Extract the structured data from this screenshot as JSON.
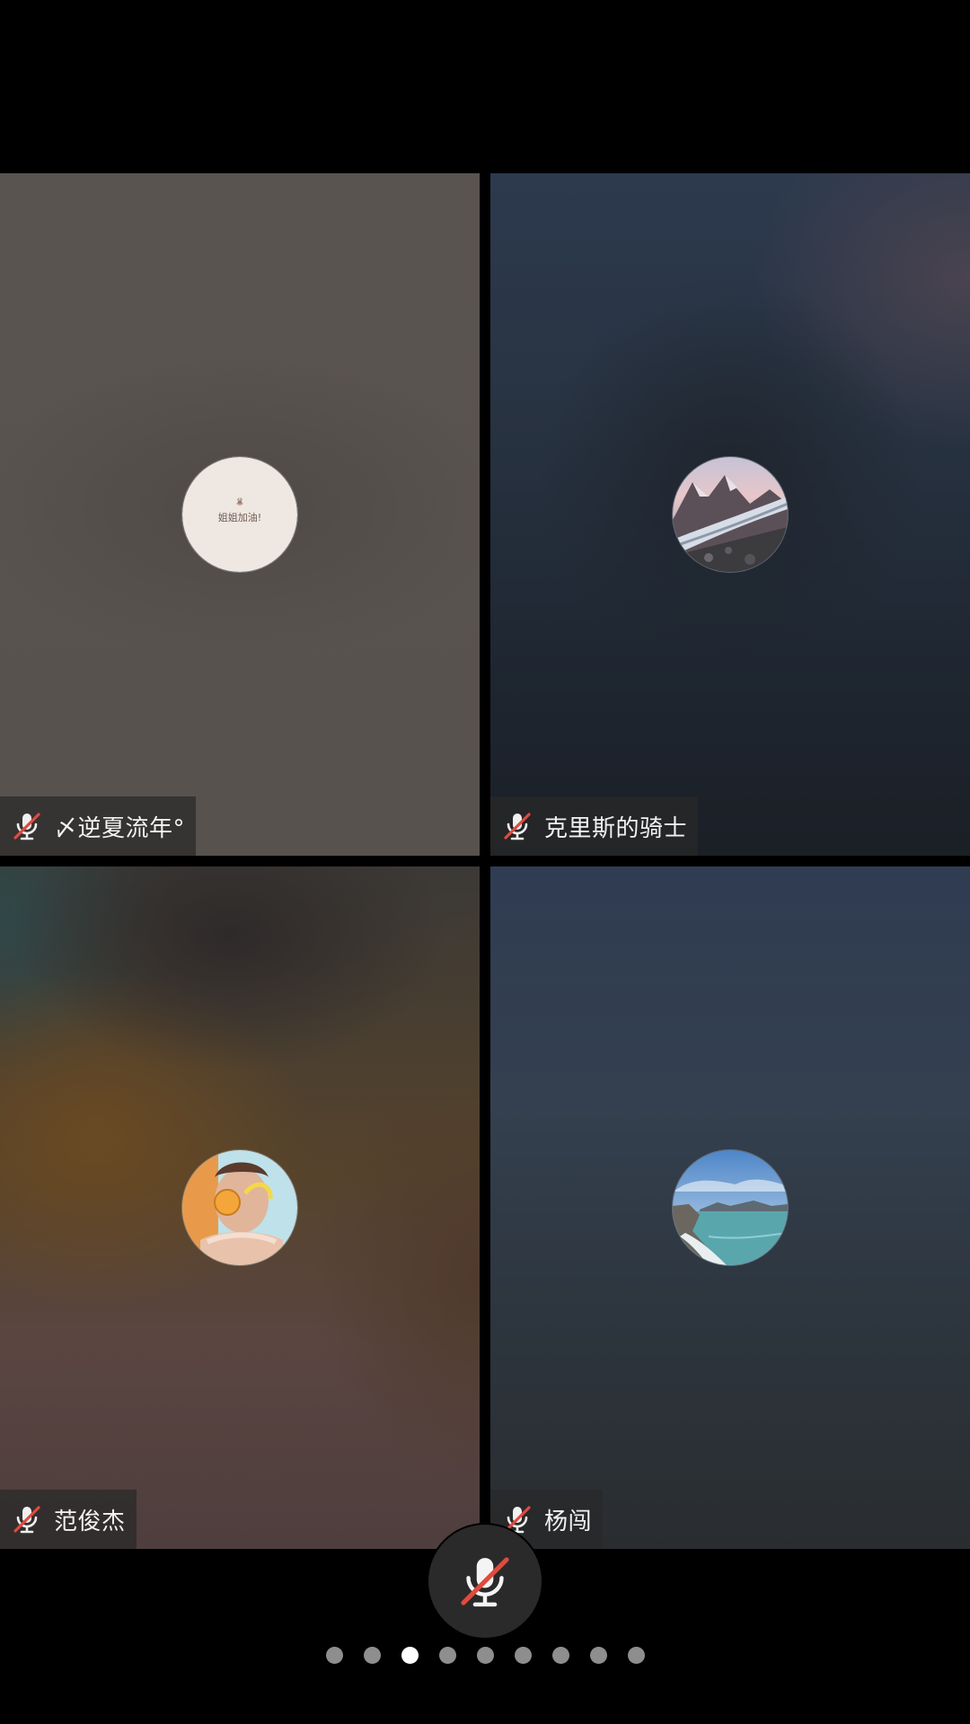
{
  "participants": [
    {
      "name": "〆逆夏流年°",
      "muted": true,
      "avatar": "handwritten-note-avatar",
      "avatar_text": "姐姐加油!"
    },
    {
      "name": "克里斯的骑士",
      "muted": true,
      "avatar": "glacier-landscape-avatar"
    },
    {
      "name": "范俊杰",
      "muted": true,
      "avatar": "man-with-glasses-avatar"
    },
    {
      "name": "杨闯",
      "muted": true,
      "avatar": "seaside-landscape-avatar"
    }
  ],
  "controls": {
    "mic": {
      "state": "muted",
      "icon": "mic-off-icon"
    }
  },
  "pager": {
    "total": 9,
    "current": 3
  },
  "colors": {
    "mute_slash": "#e04a3f",
    "active_tile_border": "#a9b6c4",
    "dot_inactive": "#8e8e8e",
    "dot_active": "#ffffff"
  }
}
